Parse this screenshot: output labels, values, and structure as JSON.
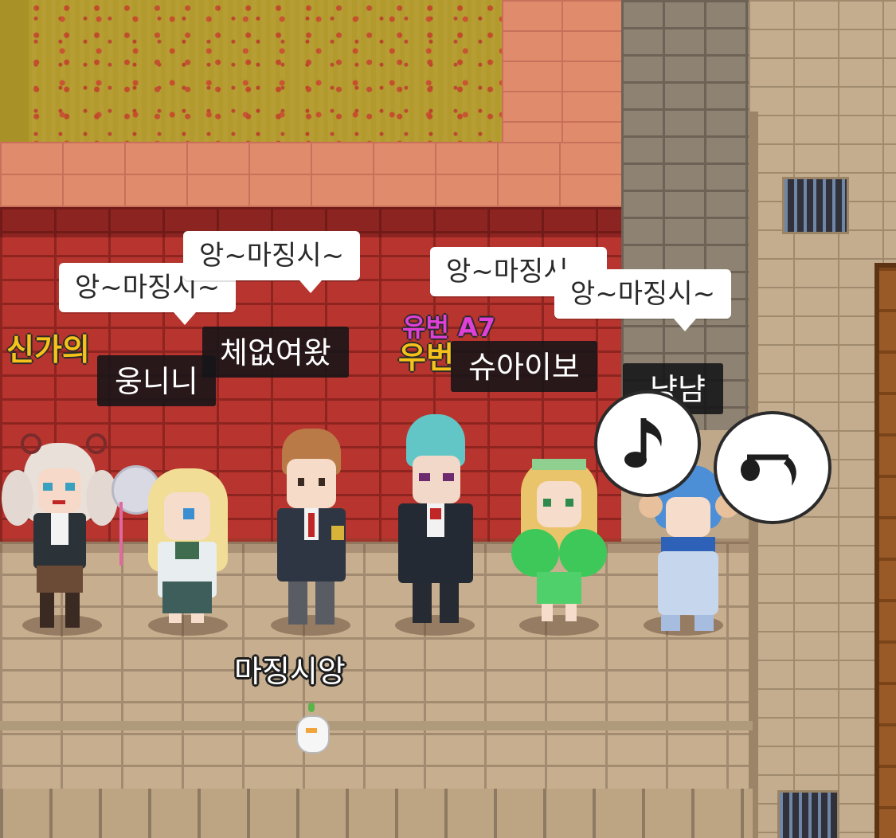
{
  "chat_bubbles": [
    {
      "id": "bubble-1",
      "text": "앙~마징시~"
    },
    {
      "id": "bubble-2",
      "text": "앙~마징시~"
    },
    {
      "id": "bubble-3",
      "text": "앙~마징시~"
    },
    {
      "id": "bubble-4",
      "text": "앙~마징시~"
    }
  ],
  "nameplates": [
    {
      "id": "plate-1",
      "name": "웅니니"
    },
    {
      "id": "plate-2",
      "name": "체없여왔"
    },
    {
      "id": "plate-3",
      "name": "슈아이보"
    },
    {
      "id": "plate-4",
      "name": "냥냠"
    }
  ],
  "colored_names": {
    "yellow_left": "신가의",
    "yellow_mid": "우번",
    "pink_mid": "유번 A7"
  },
  "emote_icons": [
    "eighth-note-icon",
    "eighth-note-sideways-icon"
  ],
  "floor_name": "마징시앙",
  "colors": {
    "brick_wall": "#b7352e",
    "nameplate_bg": "#141418",
    "yellow_name": "#f4c21a",
    "pink_name": "#e040d8"
  }
}
